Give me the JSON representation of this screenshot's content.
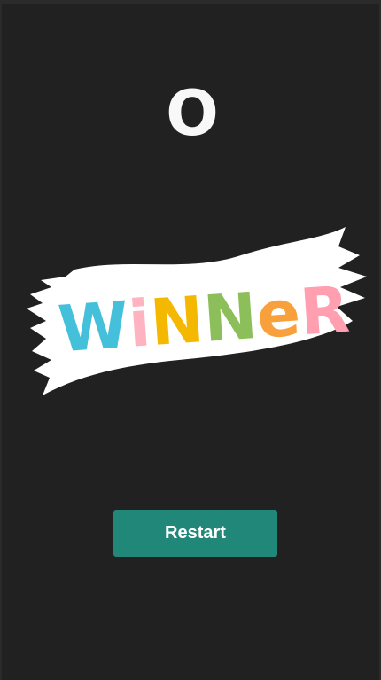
{
  "game": {
    "winner_mark": "O",
    "banner_text": "WiNNeR",
    "banner_letter_colors": [
      "#45c0db",
      "#ffb3c1",
      "#f5b800",
      "#8cbf5a",
      "#f7a03c",
      "#ff9fb0"
    ],
    "restart_label": "Restart"
  },
  "colors": {
    "background": "#212121",
    "button": "#218779",
    "banner": "#ffffff"
  }
}
